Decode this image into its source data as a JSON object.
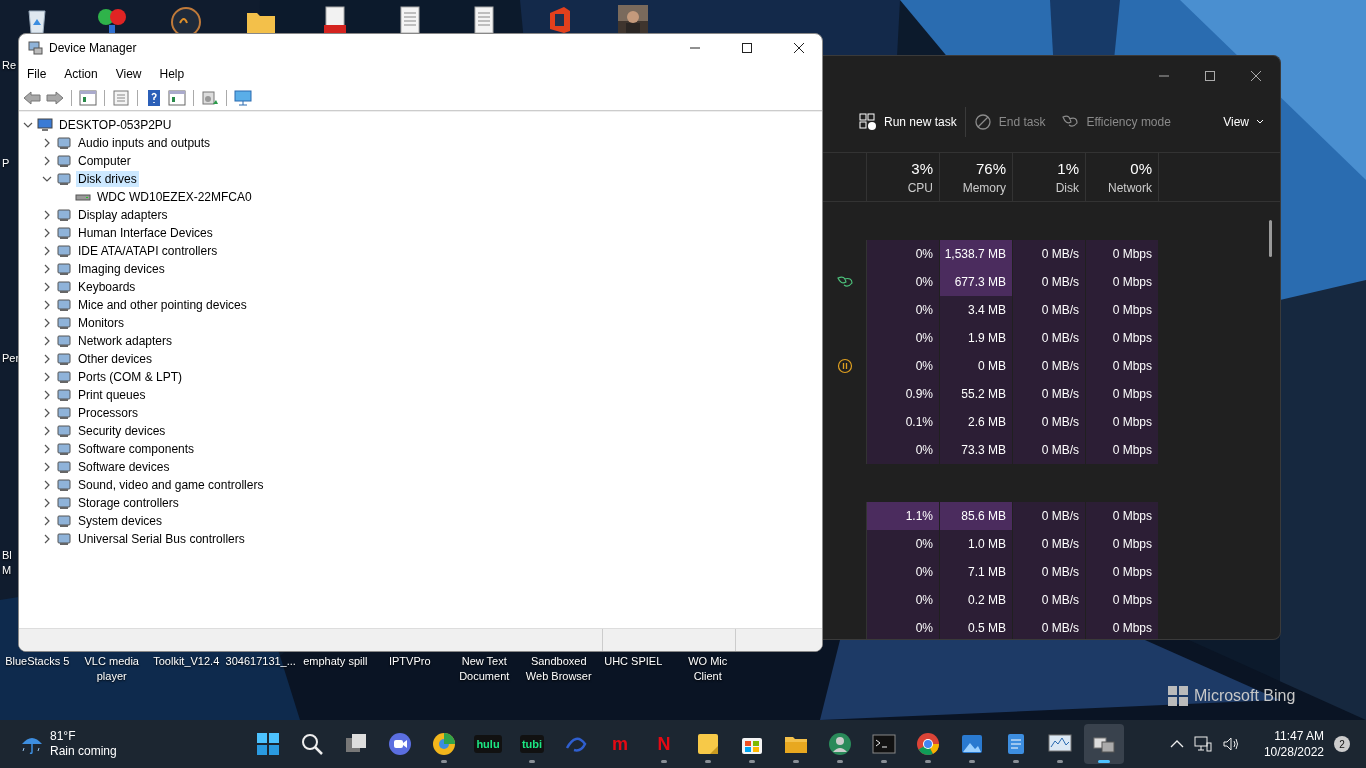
{
  "desktop": {
    "top_icons": [
      {
        "kind": "recycle"
      },
      {
        "kind": "petals"
      },
      {
        "kind": "dial"
      },
      {
        "kind": "folder"
      },
      {
        "kind": "pdf"
      },
      {
        "kind": "document"
      },
      {
        "kind": "document"
      },
      {
        "kind": "office"
      },
      {
        "kind": "picture"
      }
    ],
    "left_labels": [
      [
        "Re"
      ],
      [
        "P"
      ],
      [
        "Per"
      ],
      [
        "Bl",
        "M"
      ]
    ],
    "bottom_labels": [
      [
        "BlueStacks 5"
      ],
      [
        "VLC media",
        "player"
      ],
      [
        "Toolkit_V12.4"
      ],
      [
        "304617131_..."
      ],
      [
        "emphaty spill"
      ],
      [
        "IPTVPro"
      ],
      [
        "New Text",
        "Document"
      ],
      [
        "Sandboxed",
        "Web Browser"
      ],
      [
        "UHC SPIEL"
      ],
      [
        "WO Mic",
        "Client"
      ]
    ],
    "bing": "Microsoft Bing"
  },
  "device_manager": {
    "title": "Device Manager",
    "menu": [
      "File",
      "Action",
      "View",
      "Help"
    ],
    "toolbar": [
      {
        "kind": "back",
        "disabled": true
      },
      {
        "kind": "forward",
        "disabled": true
      },
      {
        "kind": "separator"
      },
      {
        "kind": "pane"
      },
      {
        "kind": "separator"
      },
      {
        "kind": "properties"
      },
      {
        "kind": "separator"
      },
      {
        "kind": "help"
      },
      {
        "kind": "pane"
      },
      {
        "kind": "separator"
      },
      {
        "kind": "scan"
      },
      {
        "kind": "separator"
      },
      {
        "kind": "monitor"
      }
    ],
    "tree": {
      "label": "DESKTOP-053P2PU",
      "expanded": true,
      "selected": false,
      "children": [
        {
          "label": "Audio inputs and outputs",
          "expanded": false,
          "selected": false
        },
        {
          "label": "Computer",
          "expanded": false,
          "selected": false
        },
        {
          "label": "Disk drives",
          "expanded": true,
          "selected": true,
          "children": [
            {
              "label": "WDC WD10EZEX-22MFCA0",
              "selected": false
            }
          ]
        },
        {
          "label": "Display adapters",
          "expanded": false,
          "selected": false
        },
        {
          "label": "Human Interface Devices",
          "expanded": false,
          "selected": false
        },
        {
          "label": "IDE ATA/ATAPI controllers",
          "expanded": false,
          "selected": false
        },
        {
          "label": "Imaging devices",
          "expanded": false,
          "selected": false
        },
        {
          "label": "Keyboards",
          "expanded": false,
          "selected": false
        },
        {
          "label": "Mice and other pointing devices",
          "expanded": false,
          "selected": false
        },
        {
          "label": "Monitors",
          "expanded": false,
          "selected": false
        },
        {
          "label": "Network adapters",
          "expanded": false,
          "selected": false
        },
        {
          "label": "Other devices",
          "expanded": false,
          "selected": false
        },
        {
          "label": "Ports (COM & LPT)",
          "expanded": false,
          "selected": false
        },
        {
          "label": "Print queues",
          "expanded": false,
          "selected": false
        },
        {
          "label": "Processors",
          "expanded": false,
          "selected": false
        },
        {
          "label": "Security devices",
          "expanded": false,
          "selected": false
        },
        {
          "label": "Software components",
          "expanded": false,
          "selected": false
        },
        {
          "label": "Software devices",
          "expanded": false,
          "selected": false
        },
        {
          "label": "Sound, video and game controllers",
          "expanded": false,
          "selected": false
        },
        {
          "label": "Storage controllers",
          "expanded": false,
          "selected": false
        },
        {
          "label": "System devices",
          "expanded": false,
          "selected": false
        },
        {
          "label": "Universal Serial Bus controllers",
          "expanded": false,
          "selected": false
        }
      ]
    }
  },
  "task_manager": {
    "toolbar": [
      {
        "kind": "run",
        "label": "Run new task",
        "disabled": false
      },
      {
        "kind": "end",
        "label": "End task",
        "disabled": true
      },
      {
        "kind": "efficiency",
        "label": "Efficiency mode",
        "disabled": true
      },
      {
        "kind": "view",
        "label": "View",
        "disabled": false
      }
    ],
    "columns": [
      {
        "value": "3%",
        "label": "CPU"
      },
      {
        "value": "76%",
        "label": "Memory"
      },
      {
        "value": "1%",
        "label": "Disk"
      },
      {
        "value": "0%",
        "label": "Network"
      }
    ],
    "rows": [
      {
        "kind": "group"
      },
      {
        "kind": "process",
        "cells": [
          {
            "text": "0%",
            "hot": false
          },
          {
            "text": "1,538.7 MB",
            "hot": true
          },
          {
            "text": "0 MB/s",
            "hot": false
          },
          {
            "text": "0 Mbps",
            "hot": false
          }
        ]
      },
      {
        "kind": "efficiency",
        "cells": [
          {
            "text": "0%",
            "hot": false
          },
          {
            "text": "677.3 MB",
            "hot": true
          },
          {
            "text": "0 MB/s",
            "hot": false
          },
          {
            "text": "0 Mbps",
            "hot": false
          }
        ]
      },
      {
        "kind": "process",
        "cells": [
          {
            "text": "0%",
            "hot": false
          },
          {
            "text": "3.4 MB",
            "hot": false
          },
          {
            "text": "0 MB/s",
            "hot": false
          },
          {
            "text": "0 Mbps",
            "hot": false
          }
        ]
      },
      {
        "kind": "process",
        "cells": [
          {
            "text": "0%",
            "hot": false
          },
          {
            "text": "1.9 MB",
            "hot": false
          },
          {
            "text": "0 MB/s",
            "hot": false
          },
          {
            "text": "0 Mbps",
            "hot": false
          }
        ]
      },
      {
        "kind": "suspended",
        "cells": [
          {
            "text": "0%",
            "hot": false
          },
          {
            "text": "0 MB",
            "hot": false
          },
          {
            "text": "0 MB/s",
            "hot": false
          },
          {
            "text": "0 Mbps",
            "hot": false
          }
        ]
      },
      {
        "kind": "process",
        "cells": [
          {
            "text": "0.9%",
            "hot": false
          },
          {
            "text": "55.2 MB",
            "hot": false
          },
          {
            "text": "0 MB/s",
            "hot": false
          },
          {
            "text": "0 Mbps",
            "hot": false
          }
        ]
      },
      {
        "kind": "process",
        "cells": [
          {
            "text": "0.1%",
            "hot": false
          },
          {
            "text": "2.6 MB",
            "hot": false
          },
          {
            "text": "0 MB/s",
            "hot": false
          },
          {
            "text": "0 Mbps",
            "hot": false
          }
        ]
      },
      {
        "kind": "process",
        "cells": [
          {
            "text": "0%",
            "hot": false
          },
          {
            "text": "73.3 MB",
            "hot": false
          },
          {
            "text": "0 MB/s",
            "hot": false
          },
          {
            "text": "0 Mbps",
            "hot": false
          }
        ]
      },
      {
        "kind": "group"
      },
      {
        "kind": "process",
        "cells": [
          {
            "text": "1.1%",
            "hot": true
          },
          {
            "text": "85.6 MB",
            "hot": true
          },
          {
            "text": "0 MB/s",
            "hot": false
          },
          {
            "text": "0 Mbps",
            "hot": false
          }
        ]
      },
      {
        "kind": "process",
        "cells": [
          {
            "text": "0%",
            "hot": false
          },
          {
            "text": "1.0 MB",
            "hot": false
          },
          {
            "text": "0 MB/s",
            "hot": false
          },
          {
            "text": "0 Mbps",
            "hot": false
          }
        ]
      },
      {
        "kind": "process",
        "cells": [
          {
            "text": "0%",
            "hot": false
          },
          {
            "text": "7.1 MB",
            "hot": false
          },
          {
            "text": "0 MB/s",
            "hot": false
          },
          {
            "text": "0 Mbps",
            "hot": false
          }
        ]
      },
      {
        "kind": "process",
        "cells": [
          {
            "text": "0%",
            "hot": false
          },
          {
            "text": "0.2 MB",
            "hot": false
          },
          {
            "text": "0 MB/s",
            "hot": false
          },
          {
            "text": "0 Mbps",
            "hot": false
          }
        ]
      },
      {
        "kind": "process",
        "cells": [
          {
            "text": "0%",
            "hot": false
          },
          {
            "text": "0.5 MB",
            "hot": false
          },
          {
            "text": "0 MB/s",
            "hot": false
          },
          {
            "text": "0 Mbps",
            "hot": false
          }
        ]
      }
    ]
  },
  "taskbar": {
    "weather": {
      "temp": "81°F",
      "forecast": "Rain coming"
    },
    "apps": [
      {
        "kind": "start",
        "running": false,
        "active": false
      },
      {
        "kind": "search",
        "running": false,
        "active": false
      },
      {
        "kind": "taskview",
        "running": false,
        "active": false
      },
      {
        "kind": "chat",
        "running": false,
        "active": false
      },
      {
        "kind": "browser",
        "running": true,
        "active": false
      },
      {
        "kind": "label",
        "label": "hulu",
        "running": false,
        "active": false
      },
      {
        "kind": "label",
        "label": "tubi",
        "running": true,
        "active": false
      },
      {
        "kind": "disney",
        "running": false,
        "active": false
      },
      {
        "kind": "label",
        "label": "m",
        "running": false,
        "active": false
      },
      {
        "kind": "label",
        "label": "N",
        "running": true,
        "active": false
      },
      {
        "kind": "notes",
        "running": true,
        "active": false
      },
      {
        "kind": "store",
        "running": true,
        "active": false
      },
      {
        "kind": "folder",
        "running": true,
        "active": false
      },
      {
        "kind": "avatar",
        "running": true,
        "active": false
      },
      {
        "kind": "terminal",
        "running": true,
        "active": false
      },
      {
        "kind": "chrome",
        "running": true,
        "active": false
      },
      {
        "kind": "photos",
        "running": true,
        "active": false
      },
      {
        "kind": "notepad",
        "running": true,
        "active": false
      },
      {
        "kind": "monitor",
        "running": true,
        "active": false
      },
      {
        "kind": "devices",
        "running": true,
        "active": true
      }
    ],
    "clock": {
      "time": "11:47 AM",
      "date": "10/28/2022"
    },
    "badge": "2"
  }
}
